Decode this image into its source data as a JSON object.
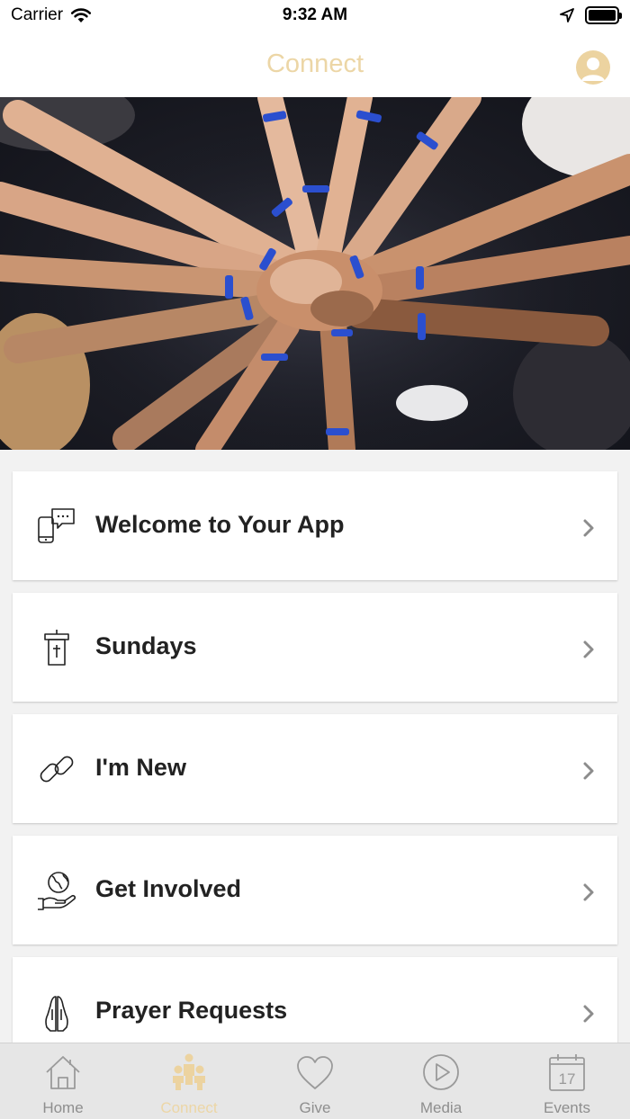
{
  "status_bar": {
    "carrier": "Carrier",
    "time": "9:32 AM"
  },
  "nav": {
    "title": "Connect"
  },
  "items": [
    {
      "label": "Welcome to Your App",
      "icon": "phone-chat-icon"
    },
    {
      "label": "Sundays",
      "icon": "pulpit-icon"
    },
    {
      "label": "I'm New",
      "icon": "link-icon"
    },
    {
      "label": "Get Involved",
      "icon": "globe-hand-icon"
    },
    {
      "label": "Prayer Requests",
      "icon": "praying-hands-icon"
    }
  ],
  "tabs": [
    {
      "label": "Home",
      "icon": "house-icon"
    },
    {
      "label": "Connect",
      "icon": "people-icon",
      "active": true
    },
    {
      "label": "Give",
      "icon": "heart-icon"
    },
    {
      "label": "Media",
      "icon": "play-circle-icon"
    },
    {
      "label": "Events",
      "icon": "calendar-icon",
      "day": "17"
    }
  ],
  "colors": {
    "accent": "#ecd6a6",
    "tab_inactive": "#8e8e8e",
    "tab_bar_bg": "#e6e6e6",
    "list_bg": "#f2f2f2"
  }
}
